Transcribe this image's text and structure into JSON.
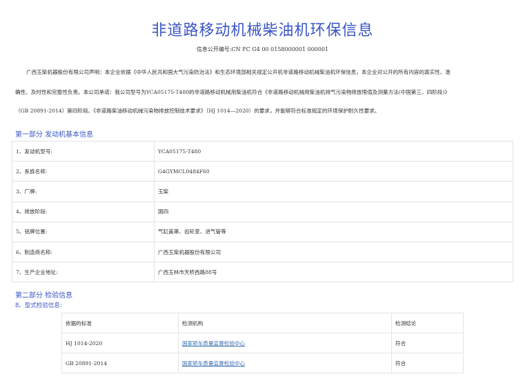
{
  "title": "非道路移动机械柴油机环保信息",
  "info_code": "信息公开编号:CN FC G4 00 0158000001 000001",
  "statement": {
    "line1": "广西玉柴机器股份有限公司声明：本企业依据《中华人民共和国大气污染防治法》和生态环境部相关规定公开机非道路移动机械柴油机环保信息，本企业对公开的所有内容的真实性、准",
    "line2": "确性、及时性和完整性负责。本公司承诺：我公司型号为YCA05175-T480的非道路移动机械用柴油机符合《非道路移动机械用柴油机排气污染物排放限值及测量方法(中国第三、四阶段)》",
    "line3": "（GB 20891-2014）第四阶段、《非道路柴油移动机械污染物排放控制技术要求》（HJ 1014—2020）的要求，并能够符合标准规定的环境保护耐久性要求。"
  },
  "part1": {
    "heading": "第一部分 发动机基本信息",
    "rows": [
      {
        "label": "1、发动机型号:",
        "value": "YCA05175-T480"
      },
      {
        "label": "2、系族名称:",
        "value": "G4GYMCL0484F60"
      },
      {
        "label": "3、厂牌:",
        "value": "玉柴"
      },
      {
        "label": "4、排放阶段:",
        "value": "国四"
      },
      {
        "label": "5、铭牌位置:",
        "value": "气缸盖罩、齿轮室、进气管等"
      },
      {
        "label": "6、制造商名称:",
        "value": "广西玉柴机器股份有限公司"
      },
      {
        "label": "7、生产企业地址:",
        "value": "广西玉林市天桥西路88号"
      }
    ]
  },
  "part2": {
    "heading": "第二部分 检验信息",
    "subheading": "8、型式检验信息:",
    "headers": [
      "依据的标准",
      "检测机构",
      "检测结论"
    ],
    "rows": [
      {
        "standard": "HJ 1014-2020",
        "agency": "国家轿车质量监督检验中心",
        "result": "符合"
      },
      {
        "standard": "GB 20891-2014",
        "agency": "国家轿车质量监督检验中心",
        "result": "符合"
      }
    ]
  }
}
